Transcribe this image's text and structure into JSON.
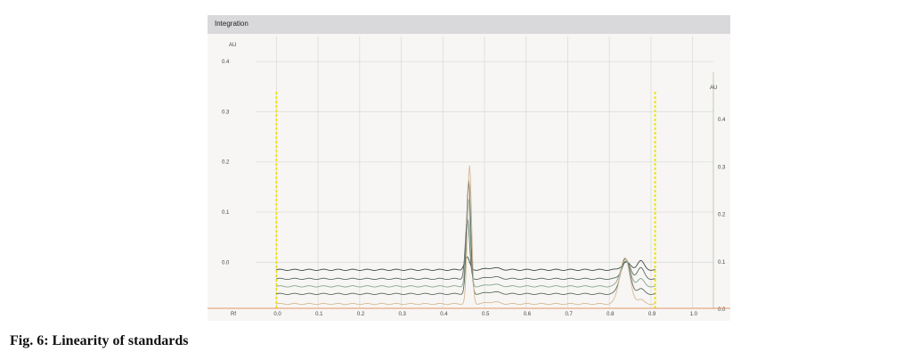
{
  "window": {
    "title": "Integration"
  },
  "caption": "Fig. 6: Linearity of standards",
  "chart_data": {
    "type": "line",
    "title": "",
    "xlabel": "Rf",
    "ylabel_left": "AU",
    "ylabel_right": "AU",
    "xlim": [
      -0.05,
      1.05
    ],
    "ylim_left": [
      -0.09,
      0.45
    ],
    "ylim_right": [
      0.0,
      0.5
    ],
    "x_ticks": [
      "0.0",
      "0.1",
      "0.2",
      "0.3",
      "0.4",
      "0.5",
      "0.6",
      "0.7",
      "0.8",
      "0.9",
      "1.0"
    ],
    "y_ticks_left": [
      "0.4",
      "0.3",
      "0.2",
      "0.1",
      "0.0"
    ],
    "y_ticks_right": [
      "0.4",
      "0.3",
      "0.2",
      "0.1",
      "0.0"
    ],
    "grid": true,
    "integration_bounds": [
      0.0,
      0.91
    ],
    "series": [
      {
        "color": "#3d4a42",
        "baseline": -0.015,
        "peaks": [
          [
            0.458,
            0.025,
            0.006
          ],
          [
            0.52,
            0.004,
            0.015
          ],
          [
            0.84,
            0.015,
            0.01
          ],
          [
            0.875,
            0.018,
            0.008
          ]
        ]
      },
      {
        "color": "#5b6a5f",
        "baseline": -0.033,
        "peaks": [
          [
            0.459,
            0.12,
            0.005
          ],
          [
            0.52,
            0.004,
            0.015
          ],
          [
            0.84,
            0.035,
            0.01
          ],
          [
            0.875,
            0.022,
            0.008
          ]
        ]
      },
      {
        "color": "#86a58b",
        "baseline": -0.048,
        "peaks": [
          [
            0.461,
            0.175,
            0.005
          ],
          [
            0.52,
            0.004,
            0.015
          ],
          [
            0.838,
            0.055,
            0.011
          ],
          [
            0.875,
            0.015,
            0.008
          ]
        ]
      },
      {
        "color": "#5c6b5e",
        "baseline": -0.063,
        "peaks": [
          [
            0.462,
            0.225,
            0.005
          ],
          [
            0.52,
            0.004,
            0.015
          ],
          [
            0.838,
            0.07,
            0.011
          ],
          [
            0.875,
            0.01,
            0.008
          ]
        ]
      },
      {
        "color": "#d6b896",
        "baseline": -0.083,
        "peaks": [
          [
            0.464,
            0.275,
            0.005
          ],
          [
            0.52,
            0.004,
            0.015
          ],
          [
            0.837,
            0.092,
            0.012
          ],
          [
            0.875,
            0.008,
            0.008
          ]
        ]
      }
    ]
  }
}
